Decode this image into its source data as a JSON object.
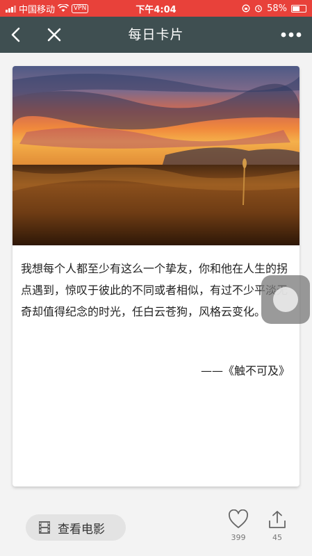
{
  "status_bar": {
    "carrier": "中国移动",
    "vpn": "VPN",
    "time": "下午4:04",
    "battery": "58%",
    "battery_level": 0.58
  },
  "nav": {
    "title": "每日卡片"
  },
  "card": {
    "quote": "我想每个人都至少有这么一个挚友，你和他在人生的拐点遇到，惊叹于彼此的不同或者相似，有过不少平淡无奇却值得纪念的时光，任白云苍狗，风格云变化。",
    "source": "——《触不可及》"
  },
  "actions": {
    "movie_label": "查看电影",
    "like_count": "399",
    "share_count": "45"
  },
  "colors": {
    "status_bar": "#e8413a",
    "nav_bar": "#3f4f51"
  }
}
